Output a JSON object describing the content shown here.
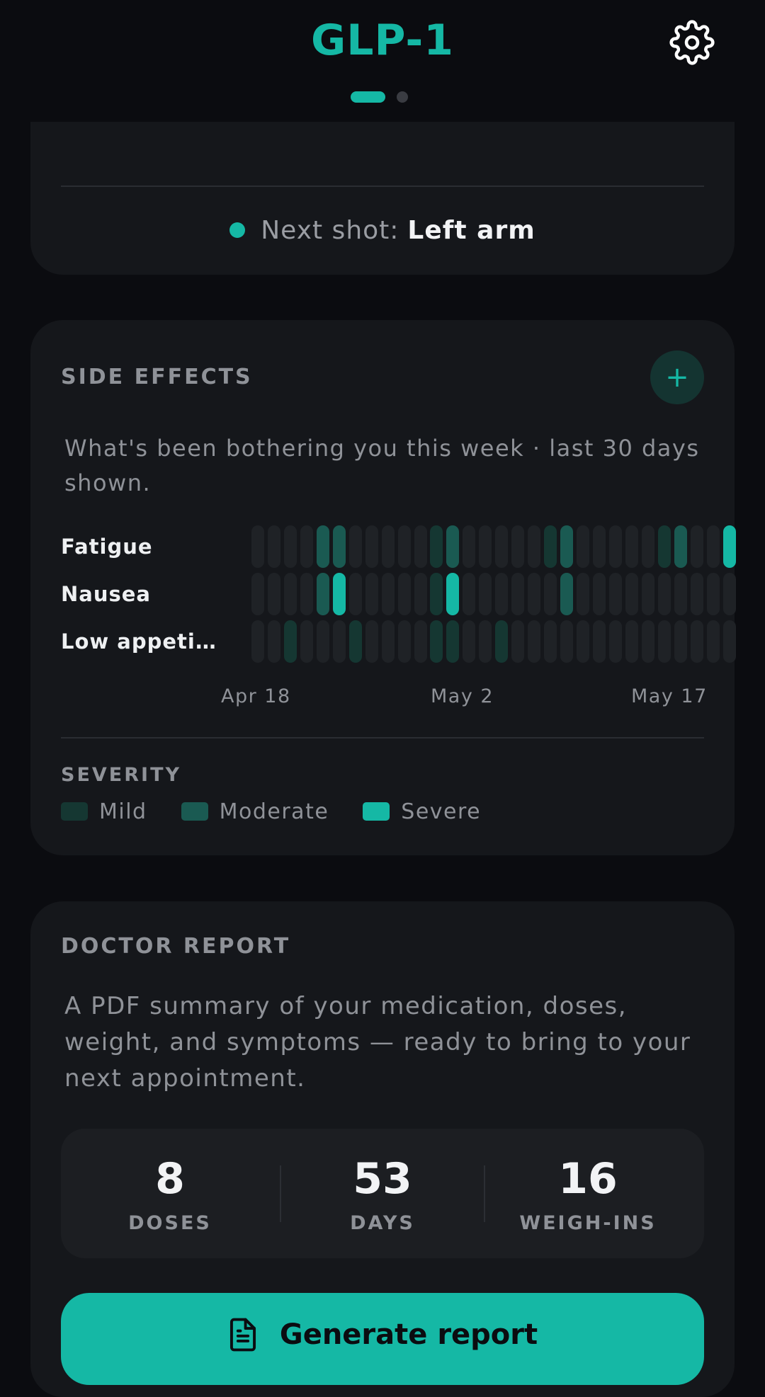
{
  "header": {
    "title": "GLP-1",
    "settings_icon": "gear-icon",
    "pager": {
      "pages": 2,
      "active": 1
    }
  },
  "injection_card": {
    "next_shot_label": "Next shot:",
    "next_shot_value": "Left arm",
    "status_color": "#15b8a5"
  },
  "side_effects": {
    "title": "SIDE EFFECTS",
    "add_label": "+",
    "description": "What's been bothering you this week · last 30 days shown.",
    "rows": [
      {
        "label": "Fatigue",
        "severity": [
          0,
          0,
          0,
          0,
          2,
          2,
          0,
          0,
          0,
          0,
          0,
          1,
          2,
          0,
          0,
          0,
          0,
          0,
          1,
          2,
          0,
          0,
          0,
          0,
          0,
          1,
          2,
          0,
          0,
          3
        ]
      },
      {
        "label": "Nausea",
        "severity": [
          0,
          0,
          0,
          0,
          2,
          3,
          0,
          0,
          0,
          0,
          0,
          1,
          3,
          0,
          0,
          0,
          0,
          0,
          0,
          2,
          0,
          0,
          0,
          0,
          0,
          0,
          0,
          0,
          0,
          0
        ]
      },
      {
        "label": "Low appeti…",
        "severity": [
          0,
          0,
          1,
          0,
          0,
          0,
          1,
          0,
          0,
          0,
          0,
          1,
          1,
          0,
          0,
          1,
          0,
          0,
          0,
          0,
          0,
          0,
          0,
          0,
          0,
          0,
          0,
          0,
          0,
          0
        ]
      }
    ],
    "axis": {
      "start": "Apr 18",
      "mid": "May 2",
      "end": "May 17"
    },
    "severity_title": "SEVERITY",
    "legend": [
      {
        "label": "Mild",
        "color": "#153732"
      },
      {
        "label": "Moderate",
        "color": "#1a5a52"
      },
      {
        "label": "Severe",
        "color": "#15b8a5"
      }
    ]
  },
  "doctor_report": {
    "title": "DOCTOR REPORT",
    "description": "A PDF summary of your medication, doses, weight, and symptoms — ready to bring to your next appointment.",
    "stats": [
      {
        "value": "8",
        "label": "DOSES"
      },
      {
        "value": "53",
        "label": "DAYS"
      },
      {
        "value": "16",
        "label": "WEIGH-INS"
      }
    ],
    "button_label": "Generate report",
    "button_icon": "document-icon"
  }
}
